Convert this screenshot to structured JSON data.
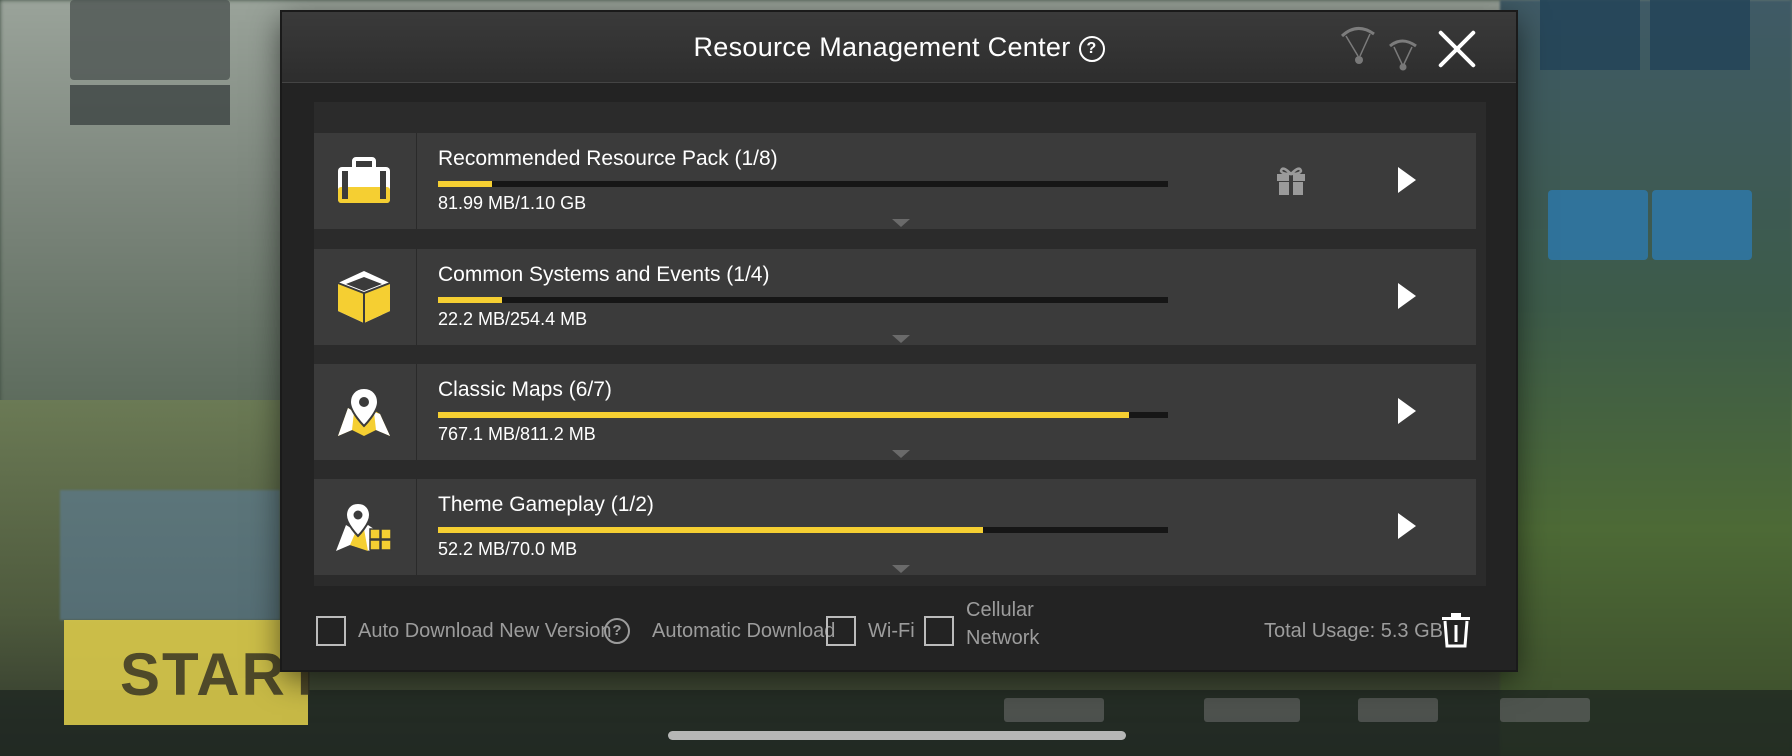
{
  "modal": {
    "title": "Resource Management Center",
    "help_glyph": "?"
  },
  "packs": [
    {
      "name": "Recommended Resource Pack (1/8)",
      "size": "81.99 MB/1.10 GB",
      "progress": 0.074,
      "icon": "briefcase-icon",
      "has_gift": true
    },
    {
      "name": "Common Systems and Events (1/4)",
      "size": "22.2 MB/254.4 MB",
      "progress": 0.087,
      "icon": "cube-icon",
      "has_gift": false
    },
    {
      "name": "Classic Maps (6/7)",
      "size": "767.1 MB/811.2 MB",
      "progress": 0.946,
      "icon": "map-pin-icon",
      "has_gift": false
    },
    {
      "name": "Theme Gameplay (1/2)",
      "size": "52.2 MB/70.0 MB",
      "progress": 0.746,
      "icon": "map-grid-icon",
      "has_gift": false
    }
  ],
  "footer": {
    "auto_download_label": "Auto Download New Version",
    "automatic_download_label": "Automatic Download",
    "wifi_label": "Wi-Fi",
    "cellular_line1": "Cellular",
    "cellular_line2": "Network",
    "total_usage": "Total Usage: 5.3 GB"
  },
  "background": {
    "start_label": "START"
  },
  "colors": {
    "accent": "#f5cf32",
    "row_bg": "#3b3b3b",
    "modal_bg": "#232323"
  }
}
